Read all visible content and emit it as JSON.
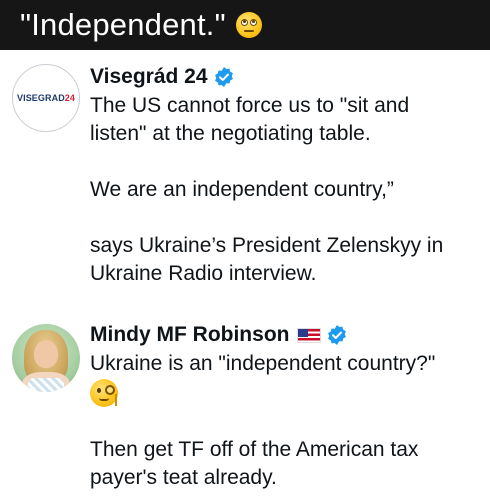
{
  "caption": {
    "text": "\"Independent.\"",
    "emoji": "face-with-rolling-eyes-icon"
  },
  "post1": {
    "author": "Visegrád 24",
    "verified": true,
    "avatar": {
      "logo_part1": "VISEGRAD",
      "logo_part2": "24"
    },
    "lines": [
      "The US cannot force us to \"sit and",
      "listen\" at the negotiating table.",
      "",
      "We are an independent country,”",
      "",
      "says Ukraine’s President Zelenskyy in",
      "Ukraine Radio interview."
    ]
  },
  "post2": {
    "author": "Mindy MF Robinson",
    "flag": "us-flag-icon",
    "verified": true,
    "lines": [
      "Ukraine is an \"independent country?\""
    ],
    "emoji": "face-with-monocle-icon",
    "lines_after": [
      "",
      "Then get TF off of the American tax",
      "payer's teat already."
    ]
  },
  "colors": {
    "topbar": "#161616",
    "verified": "#1d9bf0",
    "text": "#0f1419"
  }
}
